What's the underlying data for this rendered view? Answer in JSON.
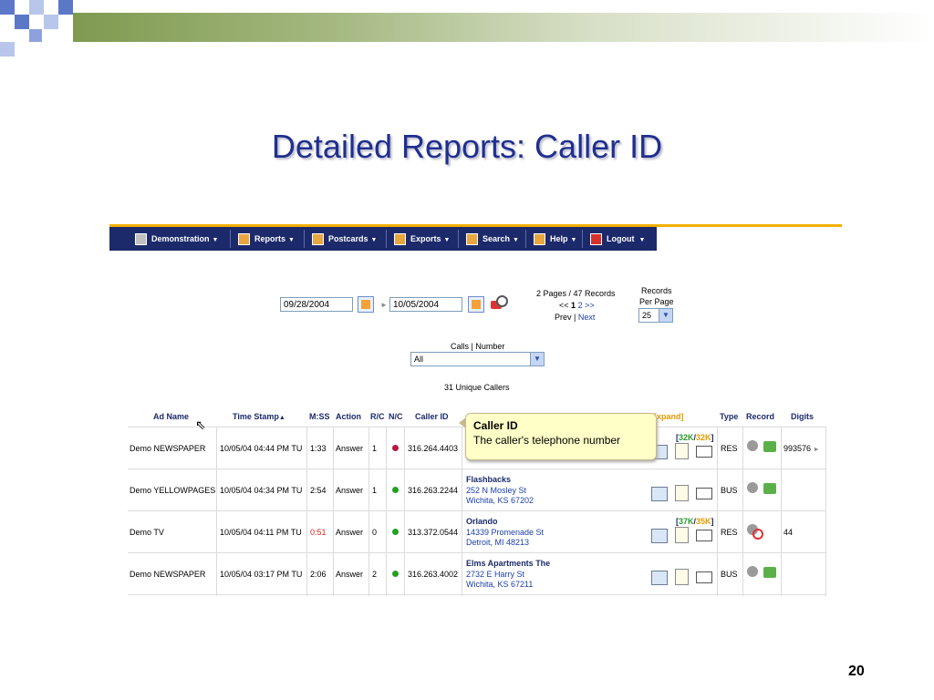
{
  "slide": {
    "title": "Detailed Reports:  Caller ID",
    "page_number": "20"
  },
  "nav": {
    "items": [
      {
        "label": "Demonstration",
        "icon": "demo-icon"
      },
      {
        "label": "Reports",
        "icon": "reports-icon"
      },
      {
        "label": "Postcards",
        "icon": "postcards-icon"
      },
      {
        "label": "Exports",
        "icon": "exports-icon"
      },
      {
        "label": "Search",
        "icon": "search-icon"
      },
      {
        "label": "Help",
        "icon": "help-icon"
      },
      {
        "label": "Logout",
        "icon": "logout-icon"
      }
    ]
  },
  "filters": {
    "start_date": "09/28/2004",
    "end_date": "10/05/2004",
    "pages_info": "2 Pages / 47 Records",
    "page_nav_prev": "<<",
    "page_current": "1",
    "page_other": "2",
    "page_nav_next": ">>",
    "prev_label": "Prev",
    "next_label": "Next",
    "records_per_page_label_1": "Records",
    "records_per_page_label_2": "Per Page",
    "records_per_page": "25",
    "calls_label": "Calls | Number",
    "calls_select": "All",
    "unique_callers": "31 Unique Callers"
  },
  "table": {
    "headers": {
      "ad_name": "Ad Name",
      "time_stamp": "Time Stamp",
      "mss": "M:SS",
      "action": "Action",
      "rc": "R/C",
      "nc": "N/C",
      "caller_id": "Caller ID",
      "expand": "Expand]",
      "type": "Type",
      "record": "Record",
      "digits": "Digits"
    },
    "rows": [
      {
        "ad_name": "Demo NEWSPAPER",
        "time": "10/05/04 04:44 PM TU",
        "mss": "1:33",
        "action": "Answer",
        "rc": "1",
        "caller_id": "316.264.4403",
        "name": "",
        "street": "",
        "city": "",
        "size_a": "32K",
        "size_b": "32K",
        "type": "RES",
        "digits": "993576",
        "nc_color": "#b8173f",
        "mss_color": "#000000"
      },
      {
        "ad_name": "Demo YELLOWPAGES",
        "time": "10/05/04 04:34 PM TU",
        "mss": "2:54",
        "action": "Answer",
        "rc": "1",
        "caller_id": "316.263.2244",
        "name": "Flashbacks",
        "street": "252 N Mosley St",
        "city": "Wichita, KS 67202",
        "size_a": "",
        "size_b": "",
        "type": "BUS",
        "digits": "",
        "nc_color": "#22a022",
        "mss_color": "#000000"
      },
      {
        "ad_name": "Demo TV",
        "time": "10/05/04 04:11 PM TU",
        "mss": "0:51",
        "action": "Answer",
        "rc": "0",
        "caller_id": "313.372.0544",
        "name": "Orlando",
        "street": "14339 Promenade St",
        "city": "Detroit, MI 48213",
        "size_a": "37K",
        "size_b": "35K",
        "type": "RES",
        "digits": "44",
        "nc_color": "#22a022",
        "mss_color": "#d9261c"
      },
      {
        "ad_name": "Demo NEWSPAPER",
        "time": "10/05/04 03:17 PM TU",
        "mss": "2:06",
        "action": "Answer",
        "rc": "2",
        "caller_id": "316.263.4002",
        "name": "Elms Apartments The",
        "street": "2732 E Harry St",
        "city": "Wichita, KS 67211",
        "size_a": "",
        "size_b": "",
        "type": "BUS",
        "digits": "",
        "nc_color": "#22a022",
        "mss_color": "#000000"
      }
    ]
  },
  "tooltip": {
    "title": "Caller ID",
    "text": "The caller's telephone number"
  },
  "colors": {
    "nav_bg": "#1c2a6b",
    "title": "#1f2f8f",
    "accent_bar": "#f0b000"
  }
}
